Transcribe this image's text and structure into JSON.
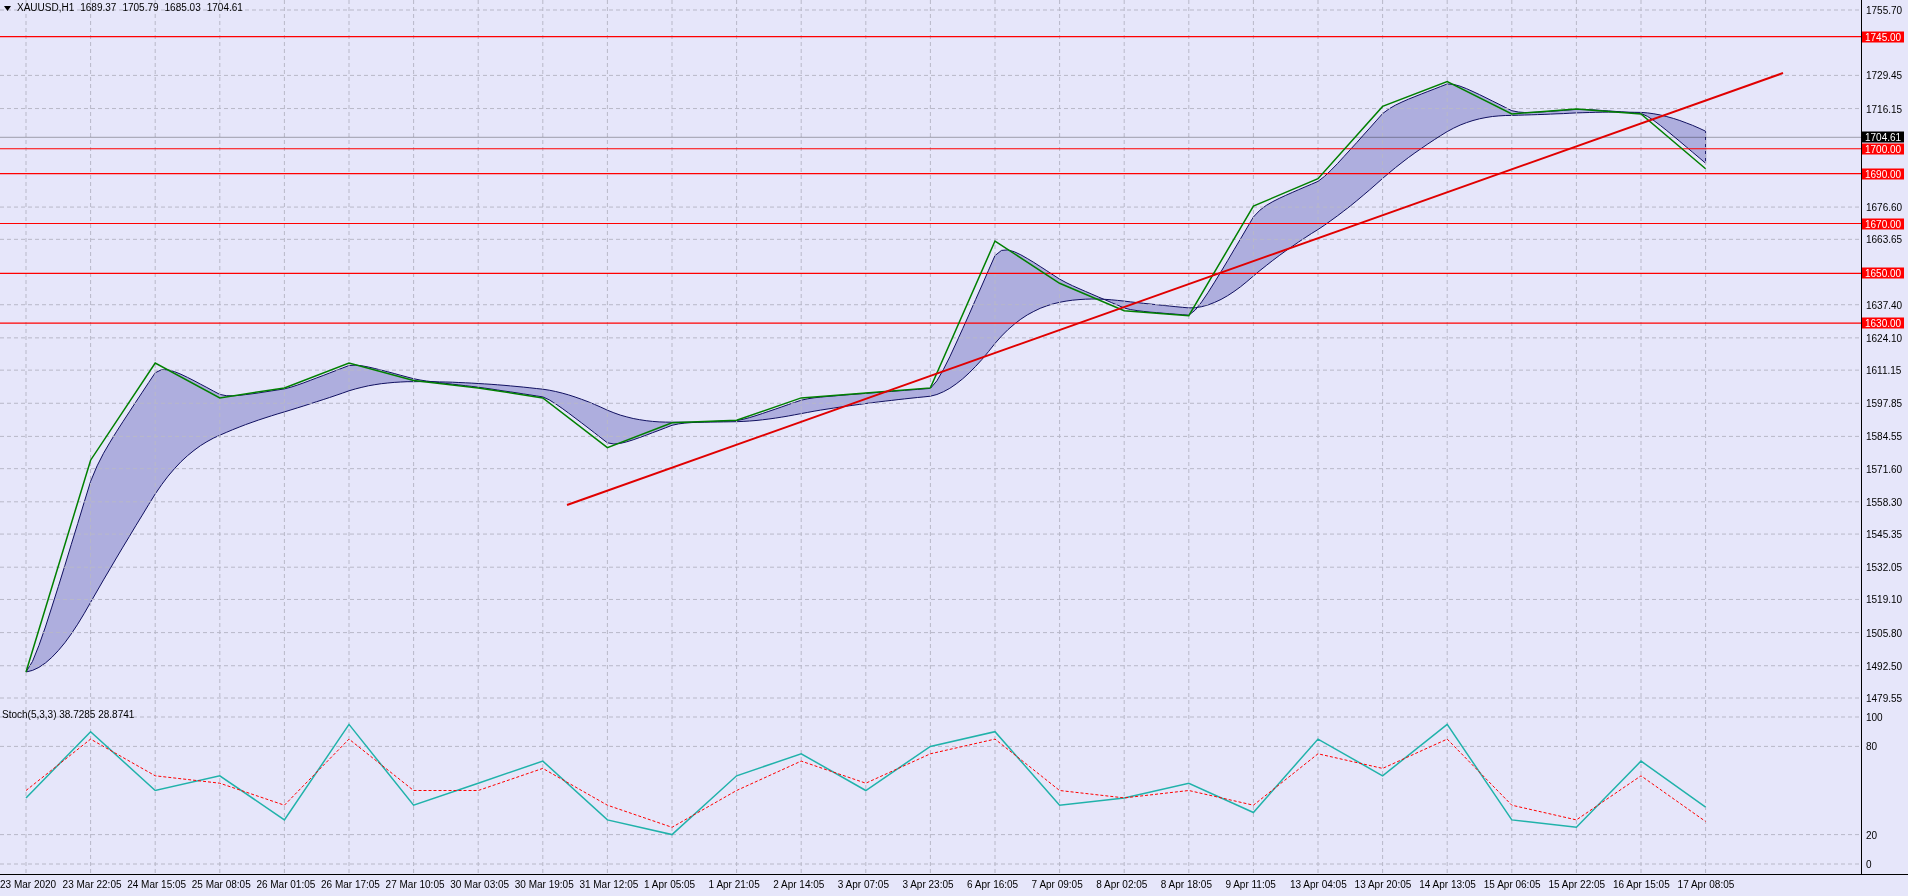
{
  "header": {
    "symbol": "XAUUSD,H1",
    "quotes": [
      "1689.37",
      "1705.79",
      "1685.03",
      "1704.61"
    ]
  },
  "price_chart": {
    "chart_data": {
      "type": "line",
      "grid": true,
      "series": [
        {
          "color": "#008000",
          "values": [
            1490,
            1575,
            1614,
            1600,
            1604,
            1614,
            1607,
            1604,
            1600,
            1580,
            1590,
            1591,
            1600,
            1602,
            1604,
            1663,
            1646,
            1635,
            1633,
            1677,
            1688,
            1717,
            1727,
            1714,
            1716,
            1714,
            1692
          ]
        }
      ],
      "ylim": [
        1479.55,
        1755.7
      ],
      "yticks": [
        {
          "value": 1755.7,
          "label": "1755.70"
        },
        {
          "value": 1729.45,
          "label": "1729.45"
        },
        {
          "value": 1716.15,
          "label": "1716.15"
        },
        {
          "value": 1676.6,
          "label": "1676.60"
        },
        {
          "value": 1663.65,
          "label": "1663.65"
        },
        {
          "value": 1637.4,
          "label": "1637.40"
        },
        {
          "value": 1624.1,
          "label": "1624.10"
        },
        {
          "value": 1611.15,
          "label": "1611.15"
        },
        {
          "value": 1597.85,
          "label": "1597.85"
        },
        {
          "value": 1584.55,
          "label": "1584.55"
        },
        {
          "value": 1571.6,
          "label": "1571.60"
        },
        {
          "value": 1558.3,
          "label": "1558.30"
        },
        {
          "value": 1545.35,
          "label": "1545.35"
        },
        {
          "value": 1532.05,
          "label": "1532.05"
        },
        {
          "value": 1519.1,
          "label": "1519.10"
        },
        {
          "value": 1505.8,
          "label": "1505.80"
        },
        {
          "value": 1492.5,
          "label": "1492.50"
        },
        {
          "value": 1479.55,
          "label": "1479.55"
        }
      ],
      "ref_lines": [
        {
          "axis": "y",
          "value": 1745,
          "label": "1745.00",
          "color": "#ff0000"
        },
        {
          "axis": "y",
          "value": 1704.61,
          "label": "1704.61",
          "color": "#000000"
        },
        {
          "axis": "y",
          "value": 1700,
          "label": "1700.00",
          "color": "#ff0000"
        },
        {
          "axis": "y",
          "value": 1690,
          "label": "1690.00",
          "color": "#ff0000"
        },
        {
          "axis": "y",
          "value": 1670,
          "label": "1670.00",
          "color": "#ff0000"
        },
        {
          "axis": "y",
          "value": 1650,
          "label": "1650.00",
          "color": "#ff0000"
        },
        {
          "axis": "y",
          "value": 1630,
          "label": "1630.00",
          "color": "#ff0000"
        }
      ]
    }
  },
  "indicator": {
    "label": "Stoch(5,3,3) 38.7285 28.8741",
    "chart_data": {
      "type": "line",
      "grid": true,
      "categories": [
        "23 Mar 2020",
        "23 Mar 22:05",
        "24 Mar 15:05",
        "25 Mar 08:05",
        "26 Mar 01:05",
        "26 Mar 17:05",
        "27 Mar 10:05",
        "30 Mar 03:05",
        "30 Mar 19:05",
        "31 Mar 12:05",
        "1 Apr 05:05",
        "1 Apr 21:05",
        "2 Apr 14:05",
        "3 Apr 07:05",
        "3 Apr 23:05",
        "6 Apr 16:05",
        "7 Apr 09:05",
        "8 Apr 02:05",
        "8 Apr 18:05",
        "9 Apr 11:05",
        "13 Apr 04:05",
        "13 Apr 20:05",
        "14 Apr 13:05",
        "15 Apr 06:05",
        "15 Apr 22:05",
        "16 Apr 15:05",
        "17 Apr 08:05"
      ],
      "series": [
        {
          "color": "#20b2aa",
          "values": [
            45,
            90,
            50,
            60,
            30,
            95,
            40,
            55,
            70,
            30,
            20,
            60,
            75,
            50,
            80,
            90,
            40,
            45,
            55,
            35,
            85,
            60,
            95,
            30,
            25,
            70,
            38.7
          ]
        },
        {
          "color": "#ff0000",
          "line_style": "dashed",
          "values": [
            50,
            85,
            60,
            55,
            40,
            85,
            50,
            50,
            65,
            40,
            25,
            50,
            70,
            55,
            75,
            85,
            50,
            45,
            50,
            40,
            75,
            65,
            85,
            40,
            30,
            60,
            28.9
          ]
        }
      ],
      "ylim": [
        0,
        100
      ],
      "yticks": [
        {
          "value": 100,
          "label": "100"
        },
        {
          "value": 80,
          "label": "80"
        },
        {
          "value": 20,
          "label": "20"
        },
        {
          "value": 0,
          "label": "0"
        }
      ]
    }
  }
}
